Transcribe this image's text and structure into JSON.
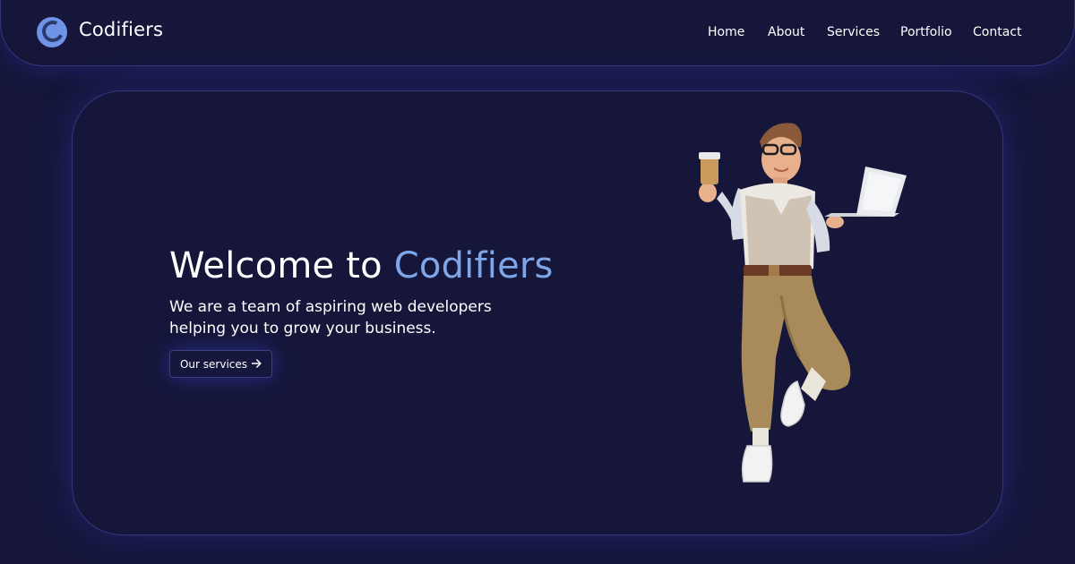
{
  "header": {
    "brand": "Codifiers",
    "nav": [
      {
        "label": "Home"
      },
      {
        "label": "About"
      },
      {
        "label": "Services"
      },
      {
        "label": "Portfolio"
      },
      {
        "label": "Contact"
      }
    ]
  },
  "hero": {
    "title_prefix": "Welcome to ",
    "title_accent": "Codifiers",
    "subtitle_line1": "We are a team of aspiring web developers",
    "subtitle_line2": "helping you to grow your business.",
    "cta_label": "Our services",
    "cta_icon": "arrow-right-icon",
    "illustration": "developer-holding-coffee-and-laptop"
  },
  "colors": {
    "background": "#15163a",
    "accent": "#7fa6e8",
    "border": "#33367a",
    "logo": "#6f93e6"
  }
}
